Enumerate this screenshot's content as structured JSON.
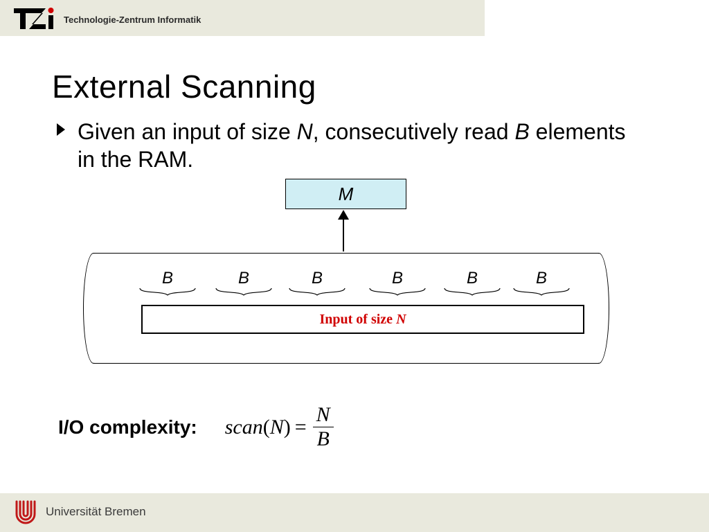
{
  "header": {
    "org_text": "Technologie-Zentrum Informatik",
    "logo_label": "TZi"
  },
  "slide": {
    "title": "External Scanning",
    "bullet": {
      "before_N": "Given an input of size ",
      "N": "N",
      "mid": ", consecutively read ",
      "B": "B",
      "after": " elements in the RAM."
    }
  },
  "diagram": {
    "m_label": "M",
    "b_labels": [
      "B",
      "B",
      "B",
      "B",
      "B",
      "B"
    ],
    "input_label_prefix": "Input of size ",
    "input_label_var": "N"
  },
  "complexity": {
    "label": "I/O complexity:",
    "fn": "scan",
    "arg": "N",
    "numerator": "N",
    "denominator": "B"
  },
  "footer": {
    "uni_text": "Universität Bremen"
  }
}
